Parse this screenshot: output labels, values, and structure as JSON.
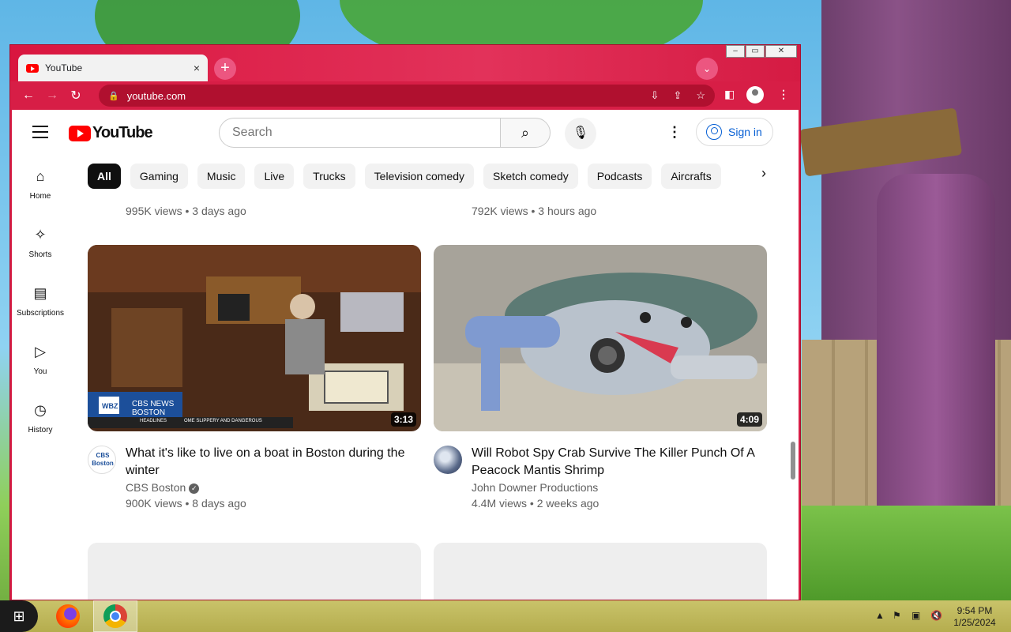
{
  "browser": {
    "tab_title": "YouTube",
    "tab_close": "×",
    "new_tab": "+",
    "tab_search": "⌄",
    "url": "youtube.com",
    "window_controls": [
      "–",
      "▭",
      "✕"
    ]
  },
  "youtube": {
    "logo_text": "YouTube",
    "search_placeholder": "Search",
    "sign_in": "Sign in",
    "chips": [
      "All",
      "Gaming",
      "Music",
      "Live",
      "Trucks",
      "Television comedy",
      "Sketch comedy",
      "Podcasts",
      "Aircrafts"
    ],
    "guide": [
      {
        "label": "Home",
        "icon": "⌂"
      },
      {
        "label": "Shorts",
        "icon": "✧"
      },
      {
        "label": "Subscriptions",
        "icon": "▤"
      },
      {
        "label": "You",
        "icon": "▷"
      },
      {
        "label": "History",
        "icon": "◷"
      }
    ],
    "top_row_meta": [
      "995K views • 3 days ago",
      "792K views • 3 hours ago"
    ],
    "videos": [
      {
        "title": "What it's like to live on a boat in Boston during the winter",
        "channel": "CBS Boston",
        "verified": true,
        "meta": "900K views • 8 days ago",
        "duration": "3:13",
        "thumb_text": "WBZ",
        "thumb_banner": "CBS NEWS BOSTON",
        "thumb_ticker": "HEADLINES",
        "thumb_ticker2": "OME SLIPPERY AND DANGEROUS",
        "avatar_text": "CBS Boston"
      },
      {
        "title": "Will Robot Spy Crab Survive The Killer Punch Of A Peacock Mantis Shrimp",
        "channel": "John Downer Productions",
        "verified": false,
        "meta": "4.4M views • 2 weeks ago",
        "duration": "4:09"
      }
    ]
  },
  "taskbar": {
    "time": "9:54 PM",
    "date": "1/25/2024"
  },
  "colors": {
    "browser_frame": "#d71e46",
    "youtube_red": "#ff0000",
    "link_blue": "#065fd4"
  }
}
